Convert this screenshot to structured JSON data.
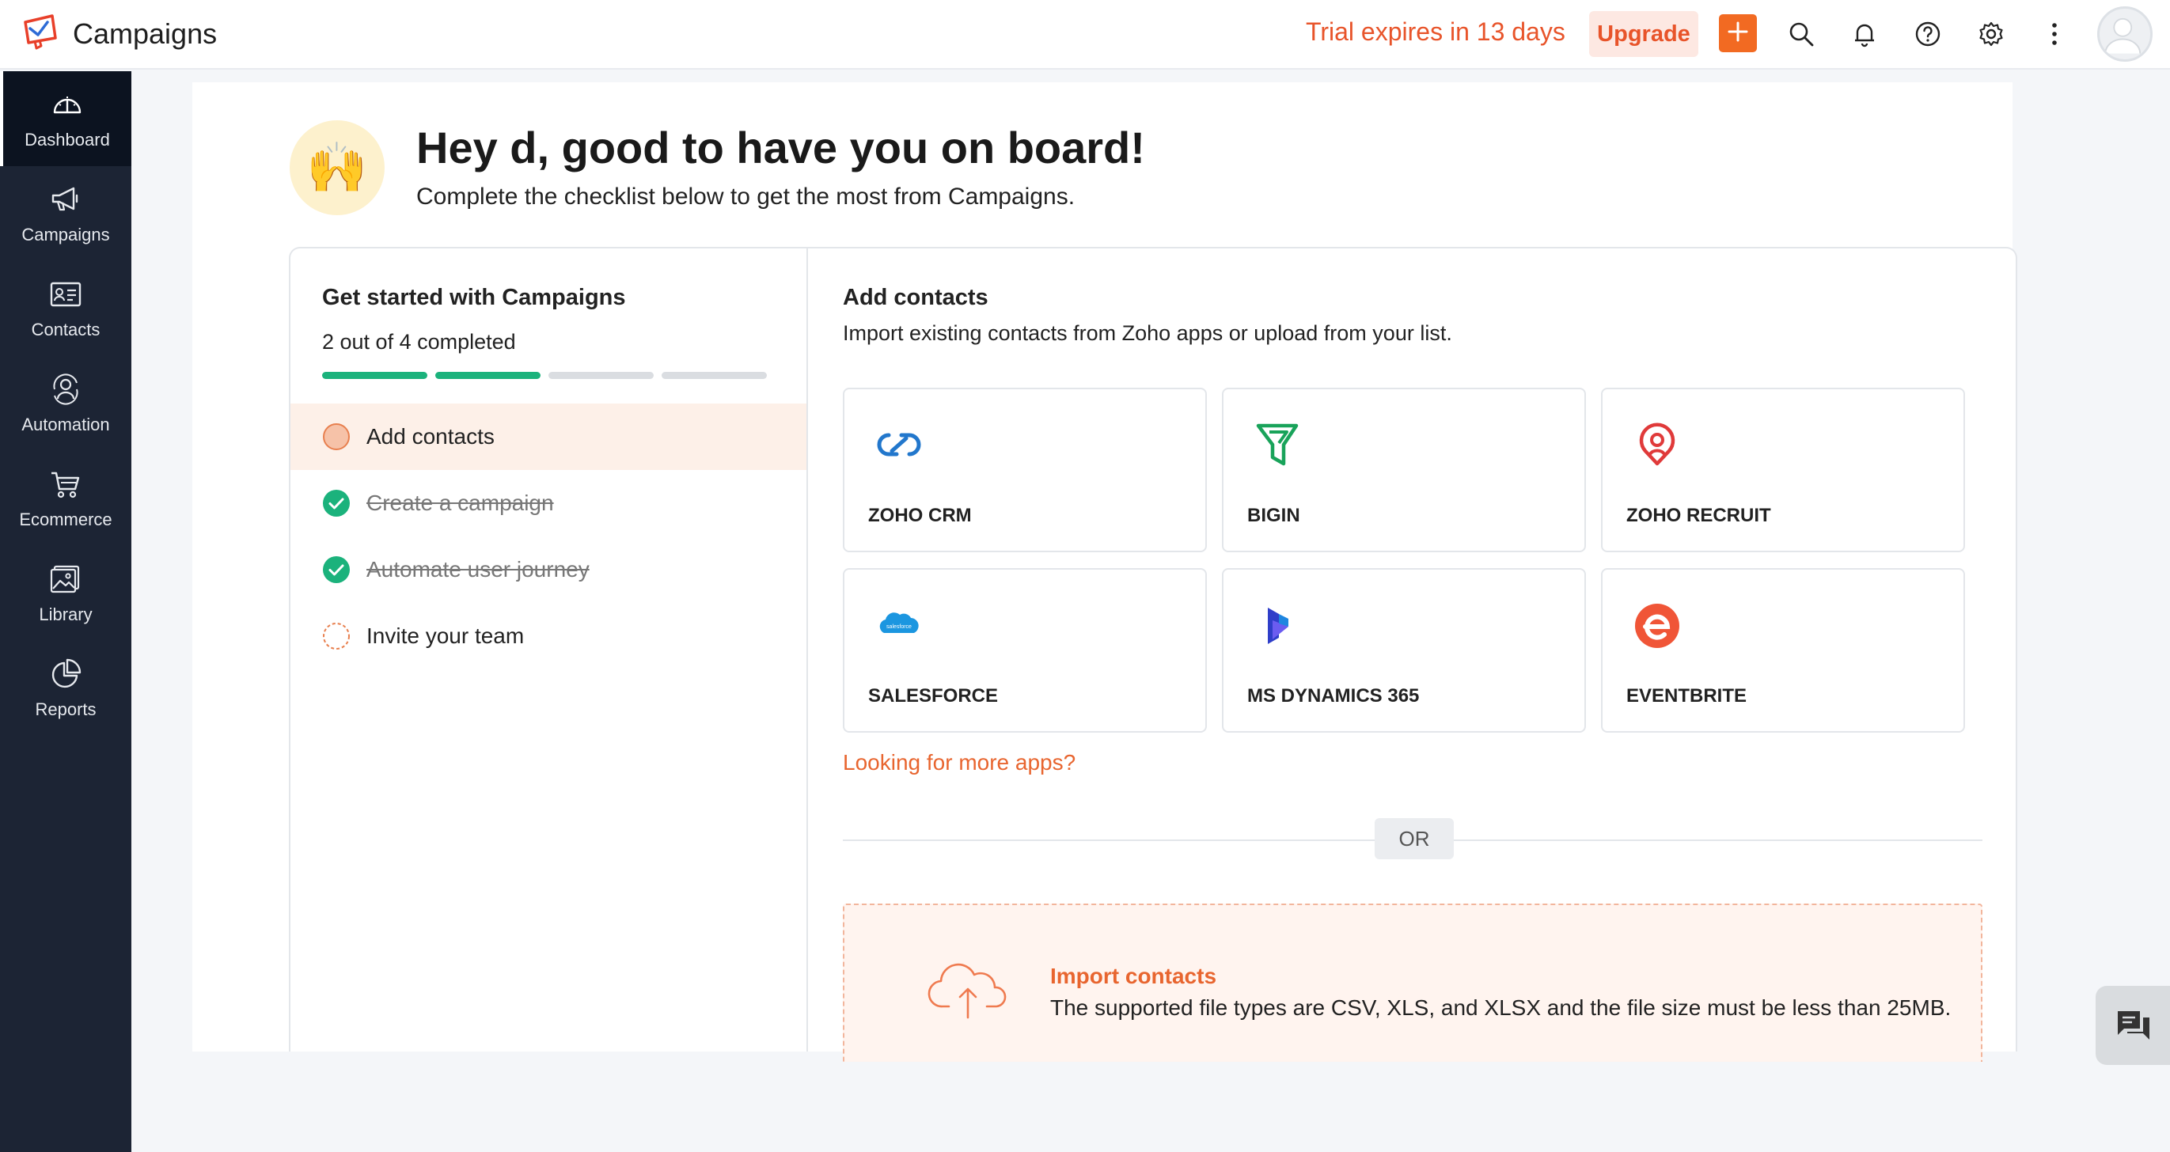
{
  "header": {
    "app_title": "Campaigns",
    "trial_text": "Trial expires in 13 days",
    "upgrade_label": "Upgrade",
    "icons": [
      "plus-icon",
      "search-icon",
      "bell-icon",
      "help-icon",
      "gear-icon",
      "more-vertical-icon",
      "avatar"
    ]
  },
  "sidebar": {
    "items": [
      {
        "label": "Dashboard",
        "icon": "gauge-icon",
        "active": true
      },
      {
        "label": "Campaigns",
        "icon": "megaphone-icon"
      },
      {
        "label": "Contacts",
        "icon": "contact-card-icon"
      },
      {
        "label": "Automation",
        "icon": "automation-icon"
      },
      {
        "label": "Ecommerce",
        "icon": "cart-icon"
      },
      {
        "label": "Library",
        "icon": "image-icon"
      },
      {
        "label": "Reports",
        "icon": "pie-chart-icon"
      }
    ]
  },
  "welcome": {
    "title": "Hey d, good to have you on board!",
    "subtitle": "Complete the checklist below to get the most from Campaigns.",
    "emoji": "🙌"
  },
  "checklist": {
    "title": "Get started with Campaigns",
    "progress_text": "2 out of 4 completed",
    "completed": 2,
    "total": 4,
    "tasks": [
      {
        "label": "Add contacts",
        "state": "active"
      },
      {
        "label": "Create a campaign",
        "state": "done"
      },
      {
        "label": "Automate user journey",
        "state": "done"
      },
      {
        "label": "Invite your team",
        "state": "pending"
      }
    ]
  },
  "add_contacts": {
    "title": "Add contacts",
    "subtitle": "Import existing contacts from Zoho apps or upload from your list.",
    "apps": [
      {
        "name": "ZOHO CRM",
        "icon": "zoho-crm-icon"
      },
      {
        "name": "BIGIN",
        "icon": "bigin-icon"
      },
      {
        "name": "ZOHO RECRUIT",
        "icon": "zoho-recruit-icon"
      },
      {
        "name": "SALESFORCE",
        "icon": "salesforce-icon",
        "logo_text": "salesforce"
      },
      {
        "name": "MS DYNAMICS 365",
        "icon": "ms-dynamics-icon"
      },
      {
        "name": "EVENTBRITE",
        "icon": "eventbrite-icon"
      }
    ],
    "more_apps_link": "Looking for more apps?",
    "or_label": "OR",
    "import": {
      "title": "Import contacts",
      "subtitle": "The supported file types are CSV, XLS, and XLSX and the file size must be less than 25MB."
    }
  },
  "colors": {
    "accent": "#e8542a",
    "sidebar_bg": "#1c2434",
    "progress_done": "#1bb27c",
    "active_task_bg": "#fdf0e8"
  }
}
